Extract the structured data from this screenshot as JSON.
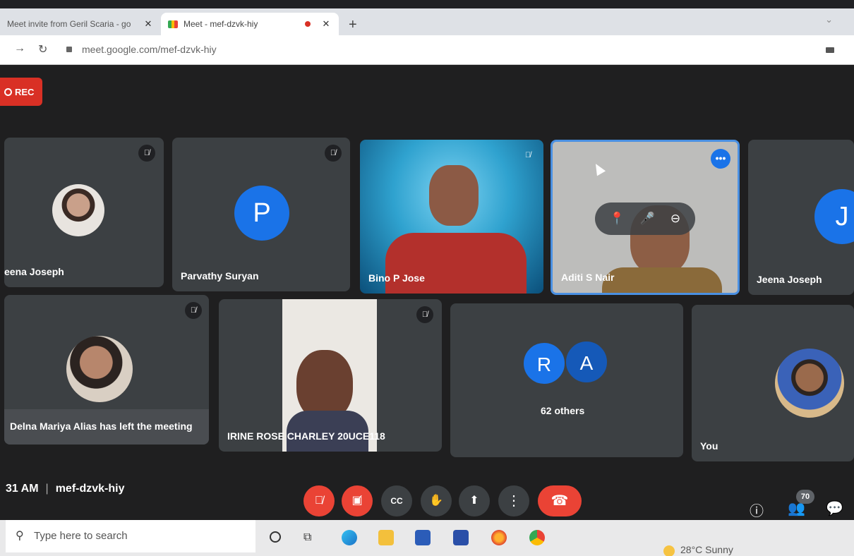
{
  "browser": {
    "tabs": [
      {
        "title": "Meet invite from Geril Scaria - go",
        "close": "✕"
      },
      {
        "title": "Meet - mef-dzvk-hiy",
        "close": "✕"
      }
    ],
    "new_tab": "+",
    "url": "meet.google.com/mef-dzvk-hiy"
  },
  "meet": {
    "rec_label": "REC",
    "meeting_code": "mef-dzvk-hiy",
    "time_fragment": "31 AM",
    "participant_count": "70",
    "tiles": {
      "t1": "eena Joseph",
      "t2": "Parvathy Suryan",
      "t2_initial": "P",
      "t3": "Bino P Jose",
      "t4": "Aditi S Nair",
      "t5": "Jeena Joseph",
      "t5_initial": "J",
      "t6_toast": "Delna Mariya Alias has left the meeting",
      "t7": "IRINE ROSE CHARLEY 20UCE118",
      "t8_initial_1": "R",
      "t8_initial_2": "A",
      "t8_label": "62 others",
      "t9": "You"
    }
  },
  "taskbar": {
    "search_placeholder": "Type here to search",
    "weather": "28°C  Sunny"
  },
  "colors": {
    "accent": "#1a73e8",
    "danger": "#ea4335",
    "tile": "#3c4043",
    "background": "#202124"
  }
}
